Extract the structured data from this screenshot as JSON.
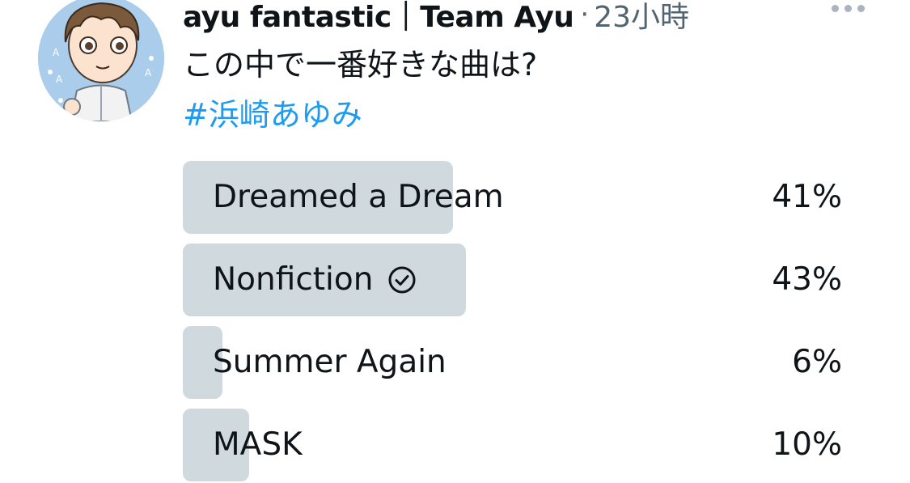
{
  "tweet": {
    "display_name": "ayu fantastic｜Team Ayu",
    "separator": "·",
    "timestamp": "23小時",
    "text": "この中で一番好きな曲は?",
    "hashtag": "#浜崎あゆみ"
  },
  "icons": {
    "more": "more-horizontal-icon",
    "winner": "check-circle-icon"
  },
  "colors": {
    "bar": "#cfd9de",
    "link": "#1d9bf0",
    "secondary_text": "#536471"
  },
  "poll": {
    "options": [
      {
        "label": "Dreamed a Dream",
        "percent": "41%",
        "value": 41,
        "winner": false
      },
      {
        "label": "Nonfiction",
        "percent": "43%",
        "value": 43,
        "winner": true
      },
      {
        "label": "Summer Again",
        "percent": "6%",
        "value": 6,
        "winner": false
      },
      {
        "label": "MASK",
        "percent": "10%",
        "value": 10,
        "winner": false
      }
    ]
  }
}
